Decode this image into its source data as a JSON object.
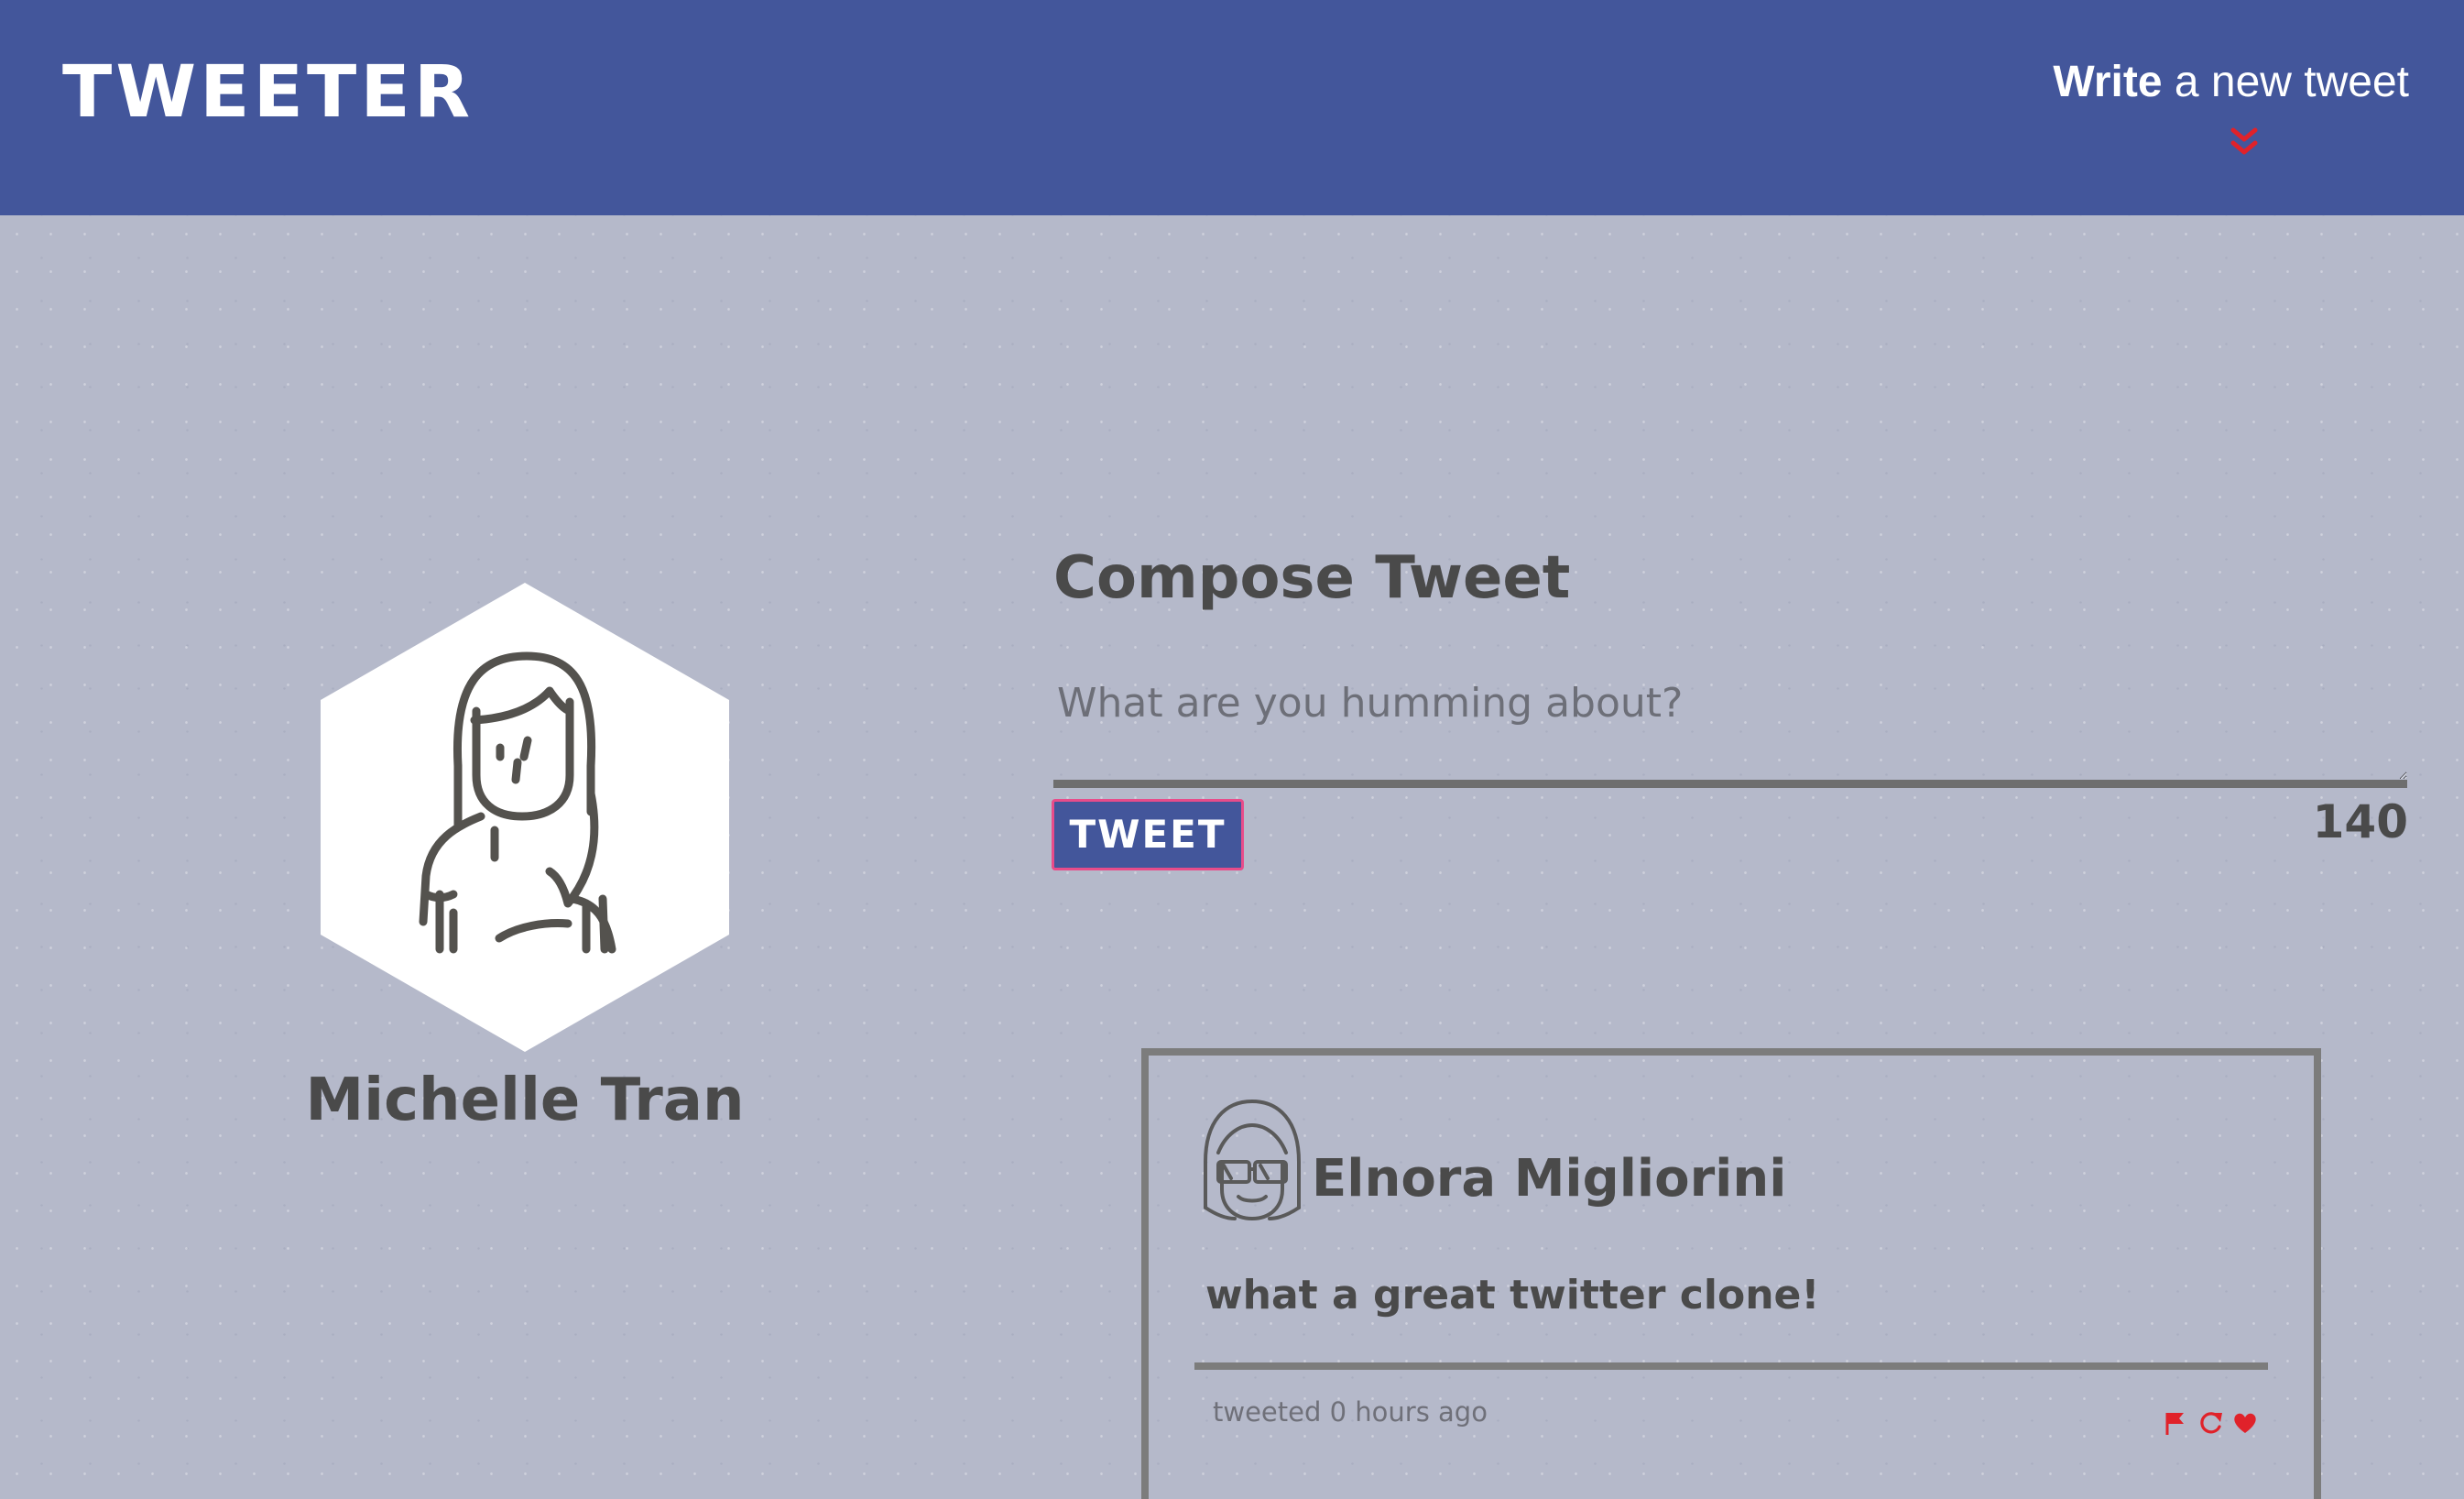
{
  "app": {
    "logo": "TWEETER"
  },
  "header": {
    "compose_toggle": {
      "bold": "Write",
      "rest": " a new tweet",
      "icon": "double-chevron-down-icon"
    }
  },
  "profile": {
    "name": "Michelle Tran",
    "avatar_icon": "woman-avatar-icon"
  },
  "compose": {
    "title": "Compose Tweet",
    "placeholder": "What are you humming about?",
    "value": "",
    "button_label": "TWEET",
    "char_count": "140"
  },
  "tweets": [
    {
      "author": "Elnora Migliorini",
      "avatar_icon": "girl-with-sunglasses-avatar-icon",
      "body": "what a great twitter clone!",
      "timestamp": "tweeted 0 hours ago",
      "actions": [
        "flag-icon",
        "retweet-icon",
        "heart-icon"
      ]
    }
  ],
  "colors": {
    "header_bg": "#43569b",
    "page_bg": "#b5b9ca",
    "accent": "#e0222a",
    "text": "#4a4a4a",
    "button_border": "#e84c8a"
  }
}
